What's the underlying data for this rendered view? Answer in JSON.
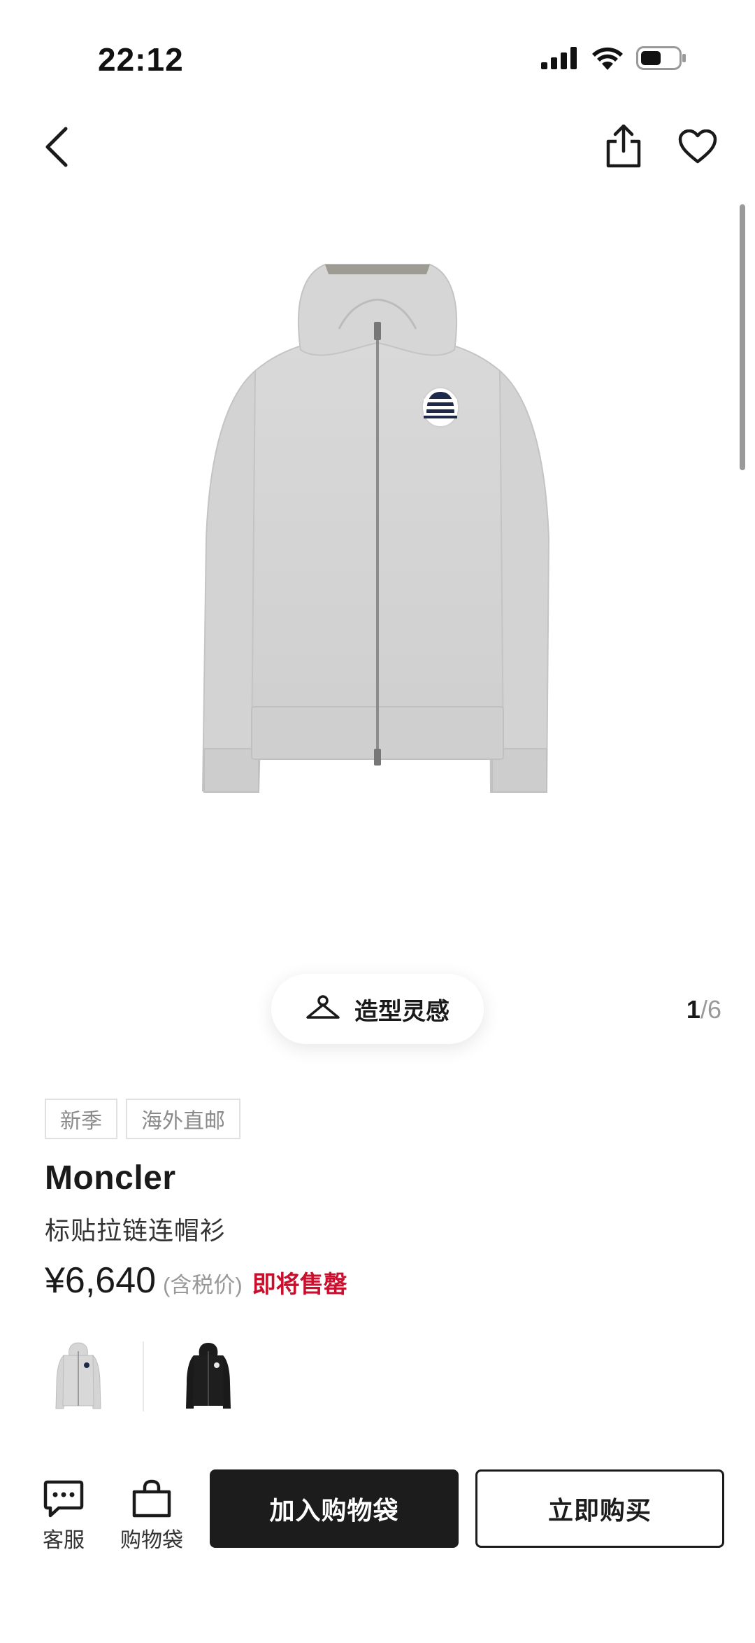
{
  "status_bar": {
    "time": "22:12"
  },
  "image_counter": {
    "current": "1",
    "separator": "/",
    "total": "6"
  },
  "styling": {
    "label": "造型灵感"
  },
  "tags": [
    "新季",
    "海外直邮"
  ],
  "product": {
    "brand": "Moncler",
    "name": "标贴拉链连帽衫",
    "price": "¥6,640",
    "tax_note": "(含税价)",
    "stock_note": "即将售罄"
  },
  "colors": {
    "stock_red": "#c8102e",
    "primary_button": "#1c1c1c",
    "hoodie_grey": "#d4d4d4",
    "hoodie_black": "#1a1a1a"
  },
  "swatches": [
    {
      "name": "grey-hoodie",
      "selected": true
    },
    {
      "name": "black-hoodie",
      "selected": false
    }
  ],
  "bottom_bar": {
    "service_label": "客服",
    "bag_label": "购物袋",
    "add_to_bag": "加入购物袋",
    "buy_now": "立即购买"
  },
  "icons": [
    "back-arrow-icon",
    "share-icon",
    "heart-icon",
    "hanger-icon",
    "chat-icon",
    "shopping-bag-icon"
  ]
}
